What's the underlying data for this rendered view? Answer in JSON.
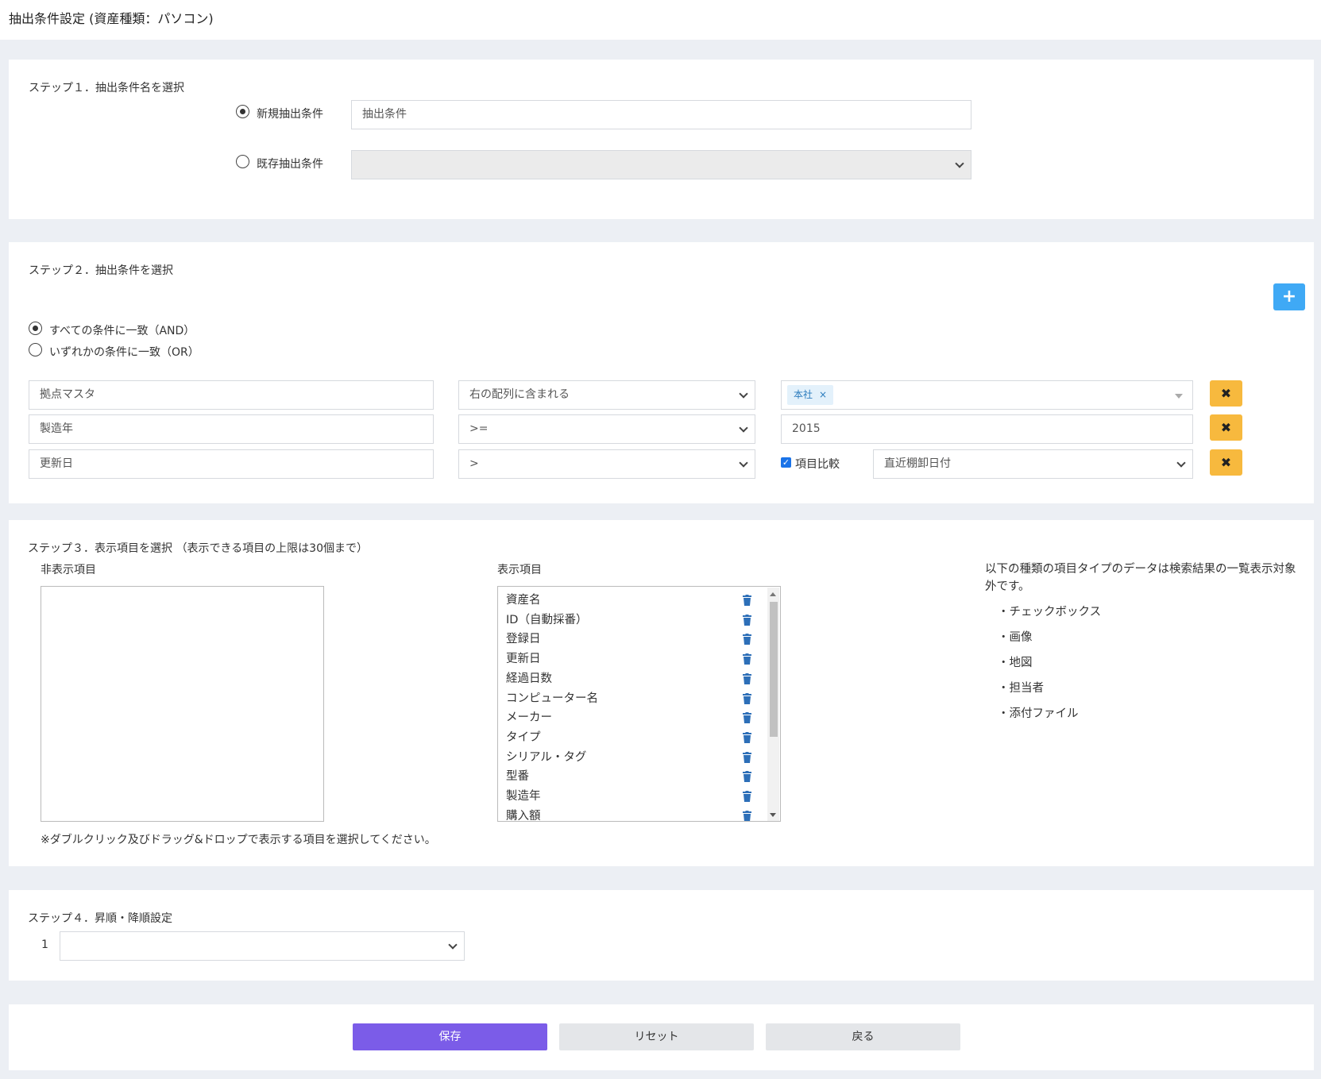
{
  "header": {
    "title": "抽出条件設定 (資産種類：パソコン)"
  },
  "step1": {
    "title": "ステップ１．抽出条件名を選択",
    "new_label": "新規抽出条件",
    "new_value": "抽出条件",
    "existing_label": "既存抽出条件",
    "existing_value": ""
  },
  "step2": {
    "title": "ステップ２．抽出条件を選択",
    "add_icon": "plus-icon",
    "match_all": "すべての条件に一致（AND）",
    "match_any": "いずれかの条件に一致（OR）",
    "rows": [
      {
        "field": "拠点マスタ",
        "operator": "右の配列に含まれる",
        "tag": "本社",
        "tag_remove": "×"
      },
      {
        "field": "製造年",
        "operator": ">=",
        "value": "2015"
      },
      {
        "field": "更新日",
        "operator": ">",
        "compare_label": "項目比較",
        "compare_field": "直近棚卸日付"
      }
    ],
    "delete_icon": "✖"
  },
  "step3": {
    "title": "ステップ３．表示項目を選択 （表示できる項目の上限は30個まで）",
    "hidden_label": "非表示項目",
    "shown_label": "表示項目",
    "shown_items": [
      "資産名",
      "ID（自動採番）",
      "登録日",
      "更新日",
      "経過日数",
      "コンピューター名",
      "メーカー",
      "タイプ",
      "シリアル・タグ",
      "型番",
      "製造年",
      "購入額"
    ],
    "hint": "※ダブルクリック及びドラッグ&ドロップで表示する項目を選択してください。",
    "note": "以下の種類の項目タイプのデータは検索結果の一覧表示対象外です。",
    "excluded_types": [
      "・チェックボックス",
      "・画像",
      "・地図",
      "・担当者",
      "・添付ファイル"
    ]
  },
  "step4": {
    "title": "ステップ４．昇順・降順設定",
    "row_number": "1",
    "sort_value": ""
  },
  "actions": {
    "save": "保存",
    "reset": "リセット",
    "back": "戻る"
  },
  "colors": {
    "background": "#eceff4",
    "primary": "#7b5ce8",
    "add": "#3fa9f5",
    "delete": "#f7b93e"
  }
}
